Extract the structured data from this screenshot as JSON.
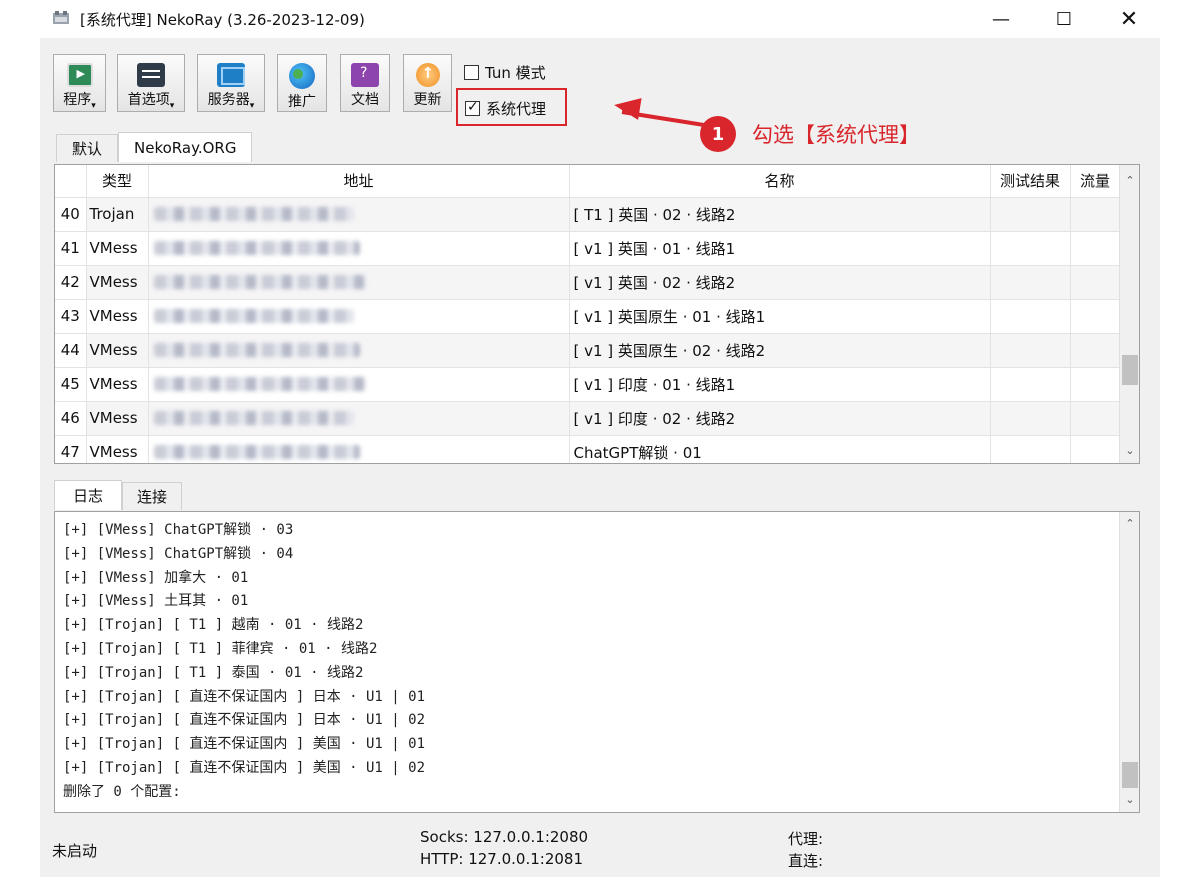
{
  "window": {
    "title": "[系统代理] NekoRay (3.26-2023-12-09)",
    "min": "—",
    "max": "☐",
    "close": "✕"
  },
  "toolbar": {
    "program": "程序",
    "prefs": "首选项",
    "servers": "服务器",
    "promo": "推广",
    "docs": "文档",
    "update": "更新",
    "tun_mode": "Tun 模式",
    "system_proxy": "系统代理",
    "system_proxy_checked": true,
    "tun_checked": false
  },
  "annotation": {
    "step": "1",
    "text": "勾选【系统代理】",
    "color": "#d9262c"
  },
  "group_tabs": [
    "默认",
    "NekoRay.ORG"
  ],
  "active_group_tab": "NekoRay.ORG",
  "server_table": {
    "columns": [
      "类型",
      "地址",
      "名称",
      "测试结果",
      "流量"
    ],
    "rows": [
      {
        "num": "40",
        "type": "Trojan",
        "name": "[ T1 ] 英国 · 02 · 线路2"
      },
      {
        "num": "41",
        "type": "VMess",
        "name": "[ v1 ] 英国 · 01 · 线路1"
      },
      {
        "num": "42",
        "type": "VMess",
        "name": "[ v1 ] 英国 · 02 · 线路2"
      },
      {
        "num": "43",
        "type": "VMess",
        "name": "[ v1 ] 英国原生 · 01 · 线路1"
      },
      {
        "num": "44",
        "type": "VMess",
        "name": "[ v1 ] 英国原生 · 02 · 线路2"
      },
      {
        "num": "45",
        "type": "VMess",
        "name": "[ v1 ] 印度 · 01 · 线路1"
      },
      {
        "num": "46",
        "type": "VMess",
        "name": "[ v1 ] 印度 · 02 · 线路2"
      },
      {
        "num": "47",
        "type": "VMess",
        "name": "ChatGPT解锁 · 01"
      }
    ]
  },
  "log_tabs": [
    "日志",
    "连接"
  ],
  "active_log_tab": "日志",
  "log": {
    "lines": [
      "[+] [VMess] ChatGPT解锁 · 03",
      "[+] [VMess] ChatGPT解锁 · 04",
      "[+] [VMess] 加拿大 · 01",
      "[+] [VMess] 土耳其 · 01",
      "[+] [Trojan] [ T1 ] 越南 · 01 · 线路2",
      "[+] [Trojan] [ T1 ] 菲律宾 · 01 · 线路2",
      "[+] [Trojan] [ T1 ] 泰国 · 01 · 线路2",
      "[+] [Trojan] [ 直连不保证国内 ] 日本 · U1 | 01",
      "[+] [Trojan] [ 直连不保证国内 ] 日本 · U1 | 02",
      "[+] [Trojan] [ 直连不保证国内 ] 美国 · U1 | 01",
      "[+] [Trojan] [ 直连不保证国内 ] 美国 · U1 | 02",
      "删除了 0 个配置:"
    ]
  },
  "status": {
    "state": "未启动",
    "socks": "Socks: 127.0.0.1:2080",
    "http": "HTTP: 127.0.0.1:2081",
    "proxy": "代理:",
    "direct": "直连:"
  }
}
